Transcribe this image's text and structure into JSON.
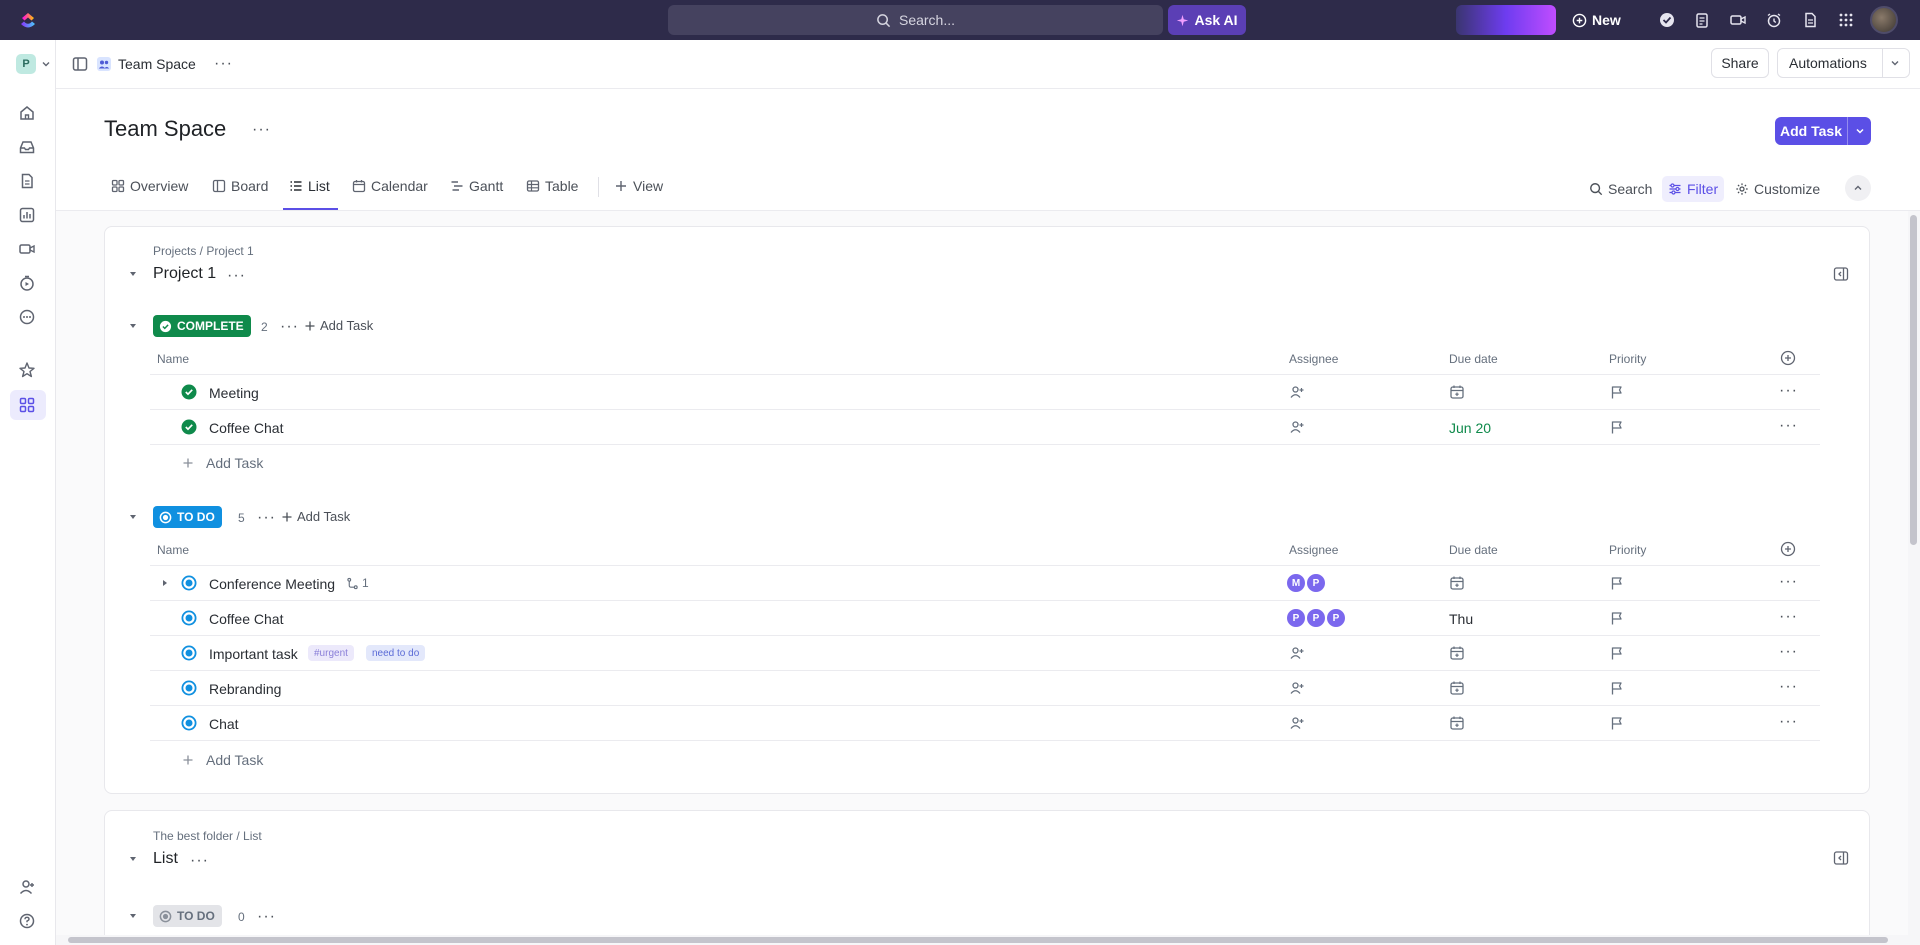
{
  "topbar": {
    "search_placeholder": "Search...",
    "ask_ai_label": "Ask AI",
    "new_label": "New"
  },
  "workspace": {
    "badge": "P"
  },
  "breadcrumb": {
    "space_name": "Team Space",
    "share_label": "Share",
    "automations_label": "Automations"
  },
  "header": {
    "title": "Team Space",
    "add_task_label": "Add Task"
  },
  "tabs": [
    {
      "label": "Overview",
      "icon": "overview-icon"
    },
    {
      "label": "Board",
      "icon": "board-icon"
    },
    {
      "label": "List",
      "icon": "list-icon",
      "active": true
    },
    {
      "label": "Calendar",
      "icon": "calendar-icon"
    },
    {
      "label": "Gantt",
      "icon": "gantt-icon"
    },
    {
      "label": "Table",
      "icon": "table-icon"
    },
    {
      "label": "View",
      "icon": "plus-icon"
    }
  ],
  "toolbar": {
    "search_label": "Search",
    "filter_label": "Filter",
    "customize_label": "Customize"
  },
  "columns": {
    "name": "Name",
    "assignee": "Assignee",
    "due_date": "Due date",
    "priority": "Priority"
  },
  "project": {
    "path": "Projects / Project 1",
    "title": "Project 1",
    "groups": [
      {
        "status": "COMPLETE",
        "color": "#0f8a4b",
        "count": "2",
        "add_label": "Add Task",
        "tasks": [
          {
            "name": "Meeting",
            "due": ""
          },
          {
            "name": "Coffee Chat",
            "due": "Jun 20",
            "due_color": "#0f8a4b"
          }
        ],
        "add_row_label": "Add Task"
      },
      {
        "status": "TO DO",
        "color": "#1090e0",
        "count": "5",
        "add_label": "Add Task",
        "tasks": [
          {
            "name": "Conference Meeting",
            "subtasks": "1",
            "assignees": [
              "M",
              "P"
            ]
          },
          {
            "name": "Coffee Chat",
            "due": "Thu",
            "assignees": [
              "P",
              "P",
              "P"
            ]
          },
          {
            "name": "Important task",
            "tags": [
              "#urgent",
              "need to do"
            ]
          },
          {
            "name": "Rebranding"
          },
          {
            "name": "Chat"
          }
        ],
        "add_row_label": "Add Task"
      }
    ]
  },
  "list_section": {
    "path": "The best folder / List",
    "title": "List",
    "group": {
      "status": "TO DO",
      "count": "0"
    }
  }
}
